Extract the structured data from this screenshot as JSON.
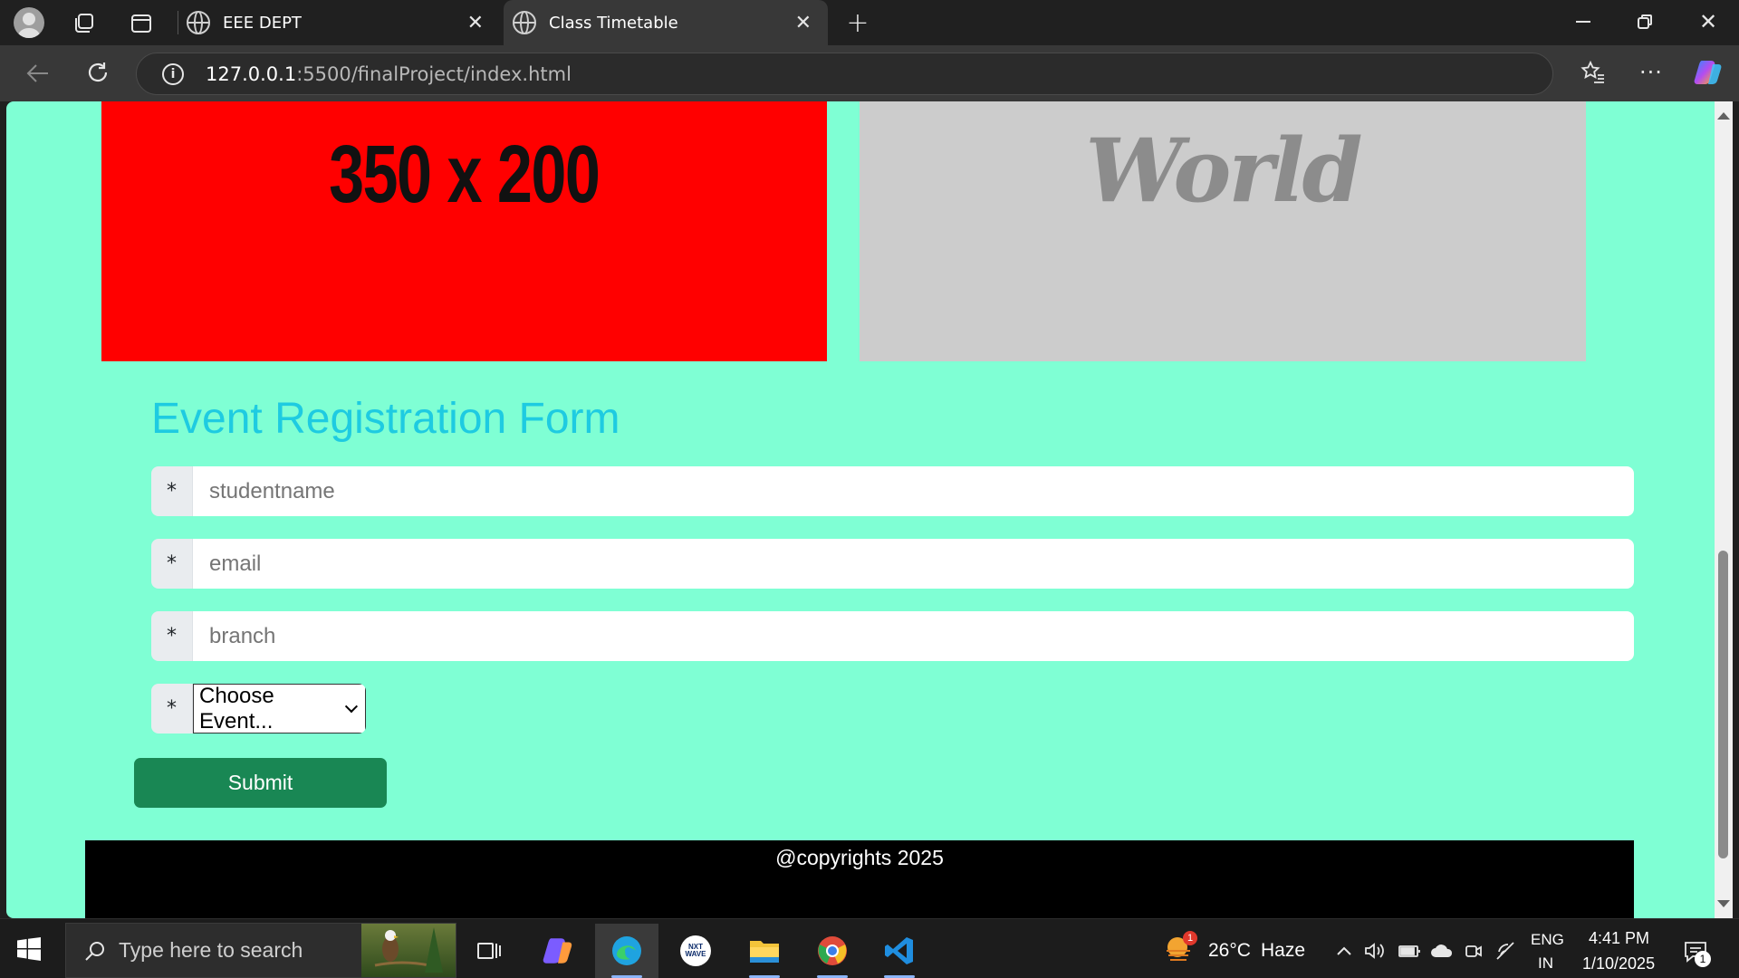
{
  "browser": {
    "tabs": [
      {
        "title": "EEE DEPT",
        "active": false
      },
      {
        "title": "Class Timetable",
        "active": true
      }
    ],
    "address": {
      "host": "127.0.0.1",
      "path": ":5500/finalProject/index.html"
    }
  },
  "page": {
    "image_left_text": "350 x 200",
    "image_right_text": "World",
    "form": {
      "title": "Event Registration Form",
      "required_marker": "*",
      "fields": {
        "studentname": {
          "placeholder": "studentname"
        },
        "email": {
          "placeholder": "email"
        },
        "branch": {
          "placeholder": "branch"
        }
      },
      "event_select": {
        "selected": "Choose Event..."
      },
      "submit_label": "Submit"
    },
    "footer": "@copyrights 2025",
    "colors": {
      "background": "#7fffd4",
      "title": "#1ecbe1",
      "submit": "#198754",
      "left_image": "#ff0000",
      "right_image": "#cccccc"
    }
  },
  "taskbar": {
    "search_placeholder": "Type here to search",
    "weather": {
      "temp": "26°C",
      "condition": "Haze",
      "badge": "1"
    },
    "language": {
      "line1": "ENG",
      "line2": "IN"
    },
    "clock": {
      "time": "4:41 PM",
      "date": "1/10/2025"
    },
    "notifications_count": "1"
  }
}
